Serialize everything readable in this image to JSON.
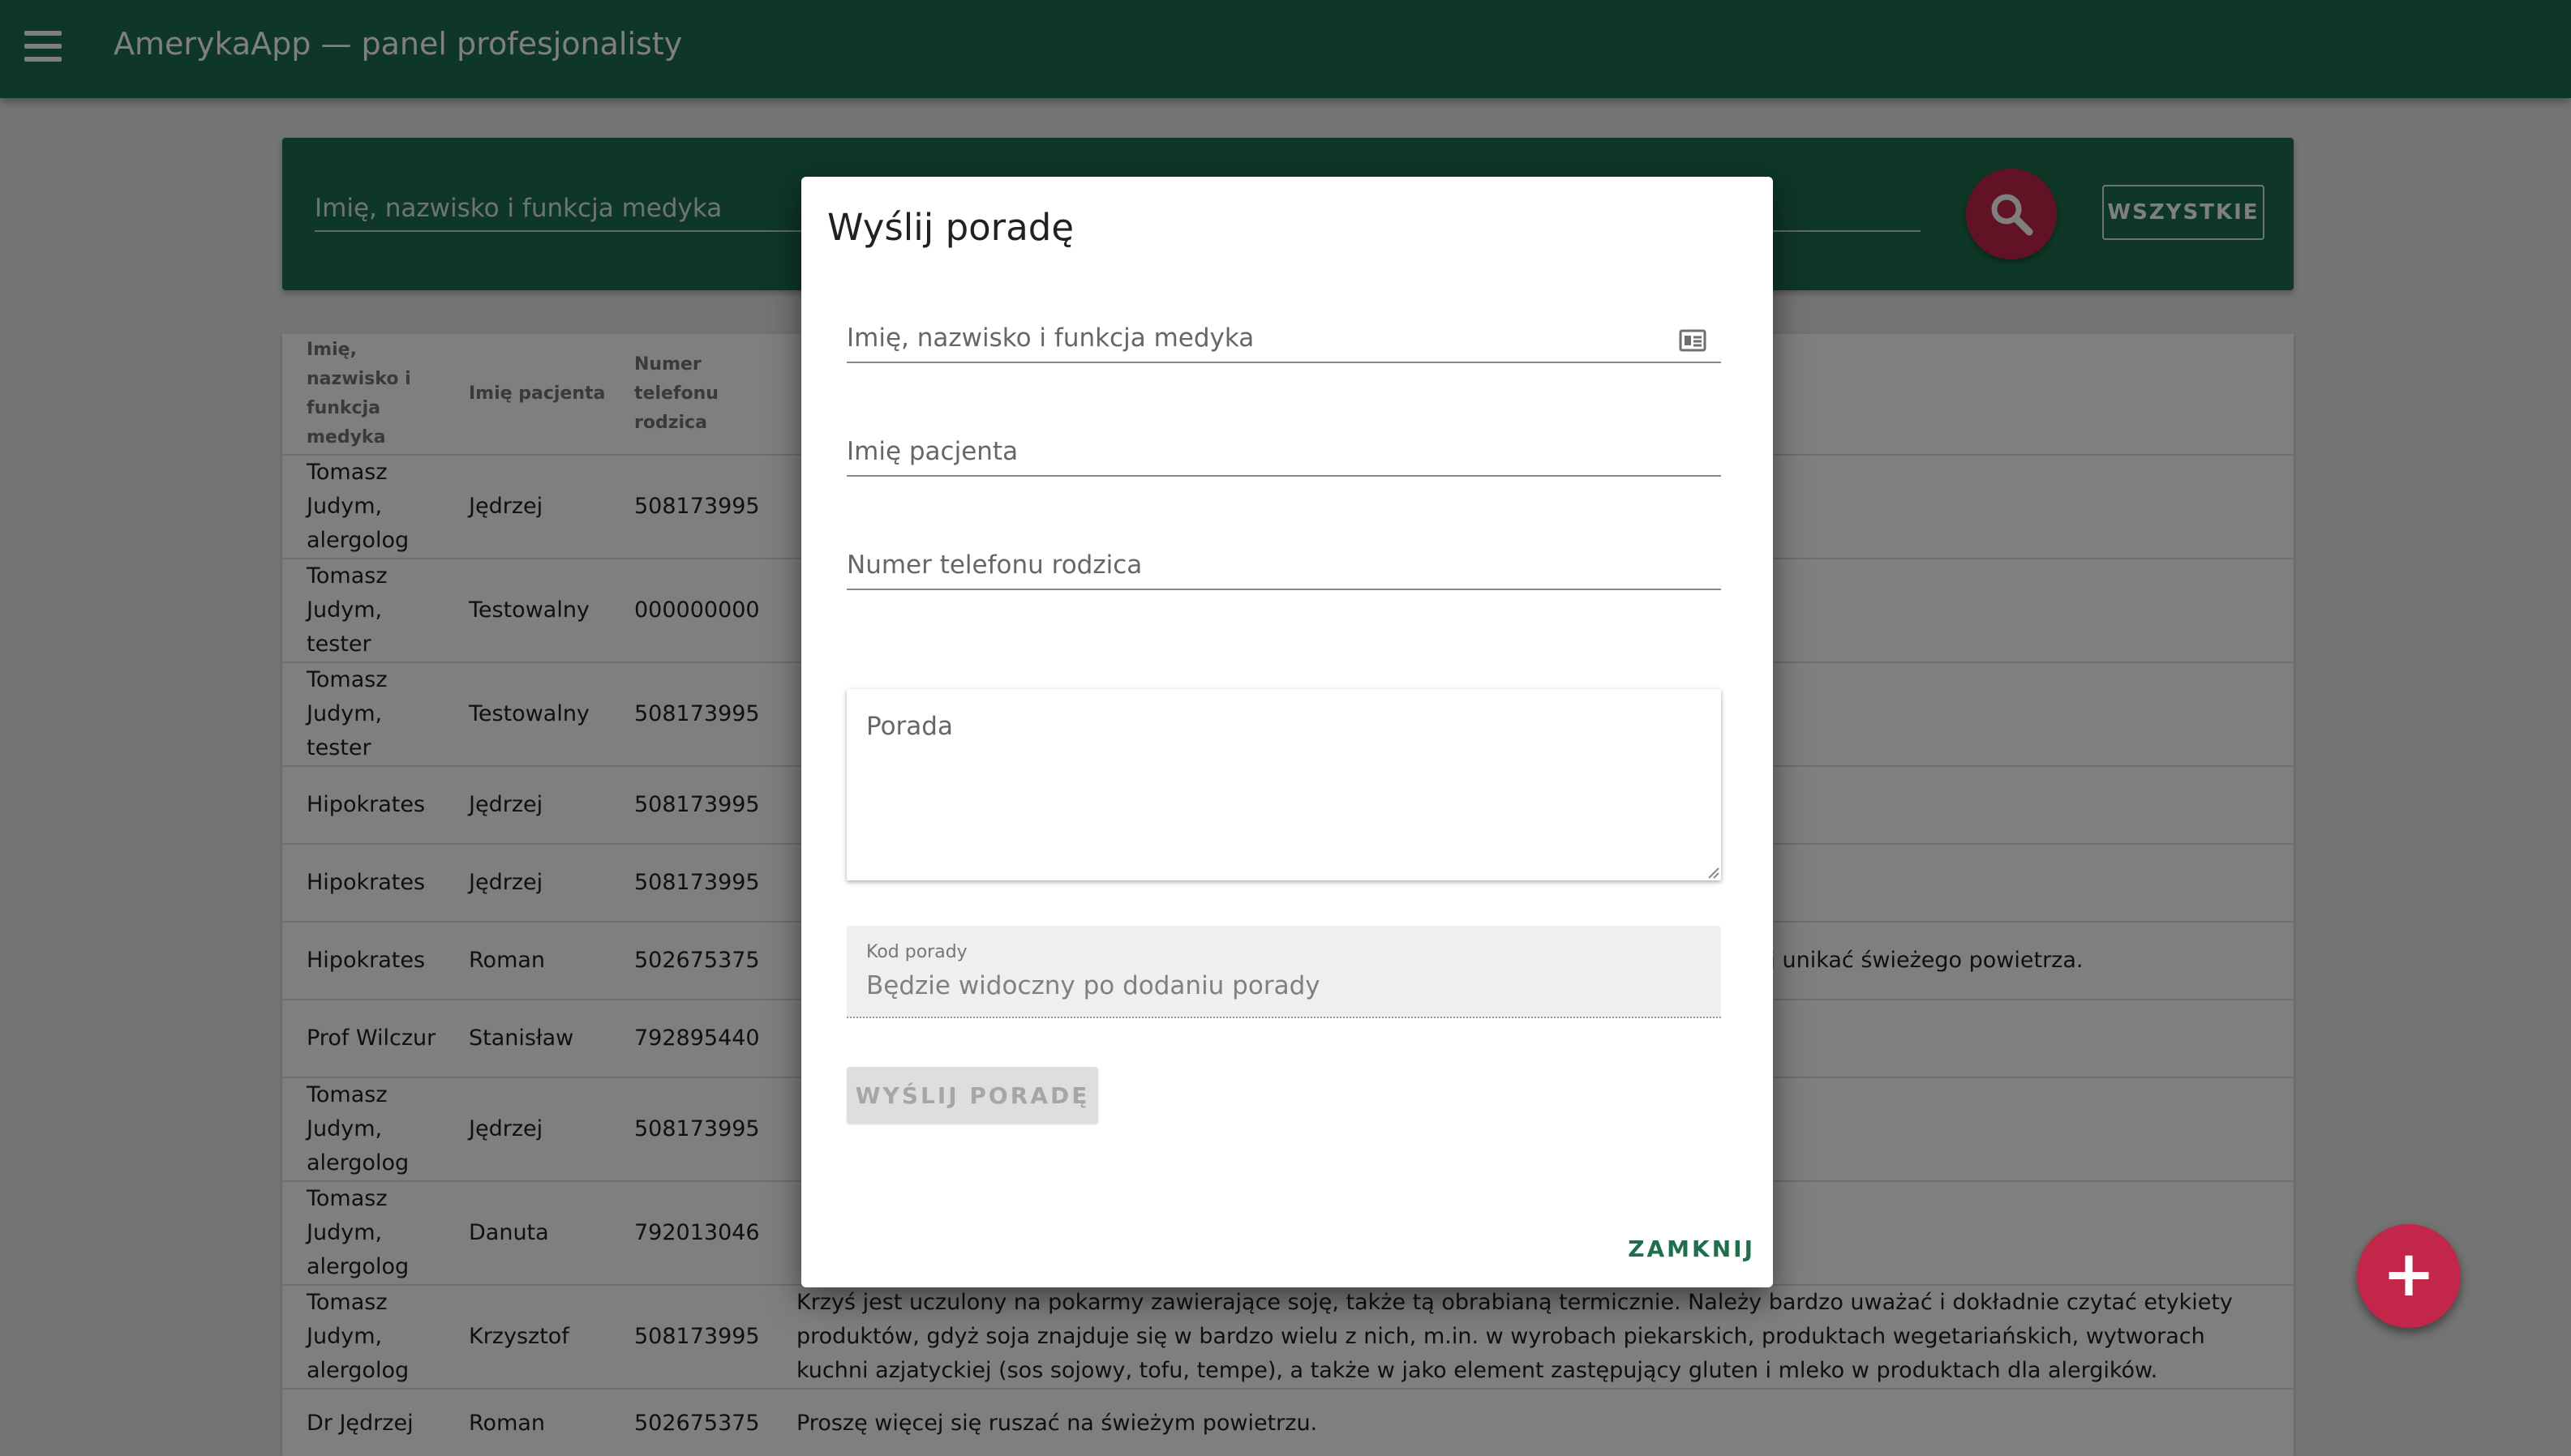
{
  "app": {
    "title": "AmerykaApp — panel profesjonalisty"
  },
  "search": {
    "placeholder": "Imię, nazwisko i funkcja medyka",
    "all_label": "WSZYSTKIE"
  },
  "table": {
    "headers": [
      "Imię, nazwisko i funkcja medyka",
      "Imię pacjenta",
      "Numer telefonu rodzica"
    ],
    "rows": [
      {
        "medic": "Tomasz Judym, alergolog",
        "patient": "Jędrzej",
        "phone": "508173995",
        "advice": ""
      },
      {
        "medic": "Tomasz Judym, tester",
        "patient": "Testowalny",
        "phone": "000000000",
        "advice": ""
      },
      {
        "medic": "Tomasz Judym, tester",
        "patient": "Testowalny",
        "phone": "508173995",
        "advice": ""
      },
      {
        "medic": "Hipokrates",
        "patient": "Jędrzej",
        "phone": "508173995",
        "advice": ""
      },
      {
        "medic": "Hipokrates",
        "patient": "Jędrzej",
        "phone": "508173995",
        "advice": ""
      },
      {
        "medic": "Hipokrates",
        "patient": "Roman",
        "phone": "502675375",
        "advice": "ajlepiej unikać świeżego powietrza."
      },
      {
        "medic": "Prof Wilczur",
        "patient": "Stanisław",
        "phone": "792895440",
        "advice": ""
      },
      {
        "medic": "Tomasz Judym, alergolog",
        "patient": "Jędrzej",
        "phone": "508173995",
        "advice": ""
      },
      {
        "medic": "Tomasz Judym, alergolog",
        "patient": "Danuta",
        "phone": "792013046",
        "advice": ""
      },
      {
        "medic": "Tomasz Judym, alergolog",
        "patient": "Krzysztof",
        "phone": "508173995",
        "advice": "Krzyś jest uczulony na pokarmy zawierające soję, także tą obrabianą termicznie. Należy bardzo uważać i dokładnie czytać etykiety produktów, gdyż soja znajduje się w bardzo wielu z nich, m.in. w wyrobach piekarskich, produktach wegetariańskich, wytworach kuchni azjatyckiej (sos sojowy, tofu, tempe), a także w jako element zastępujący gluten i mleko w produktach dla alergików."
      },
      {
        "medic": "Dr Jędrzej",
        "patient": "Roman",
        "phone": "502675375",
        "advice": "Proszę więcej się ruszać na świeżym powietrzu."
      }
    ]
  },
  "dialog": {
    "title": "Wyślij poradę",
    "medic_placeholder": "Imię, nazwisko i funkcja medyka",
    "patient_placeholder": "Imię pacjenta",
    "phone_placeholder": "Numer telefonu rodzica",
    "advice_placeholder": "Porada",
    "code_label": "Kod porady",
    "code_value": "Będzie widoczny po dodaniu porady",
    "send_label": "WYŚLIJ PORADĘ",
    "close_label": "ZAMKNIJ"
  },
  "fab": {
    "label": "+"
  },
  "colors": {
    "primary": "#1d6f4e",
    "accent": "#c2274a"
  },
  "icons": {
    "menu": "menu-icon",
    "search": "search-icon",
    "id_card": "id-card-icon",
    "add": "add-icon"
  }
}
